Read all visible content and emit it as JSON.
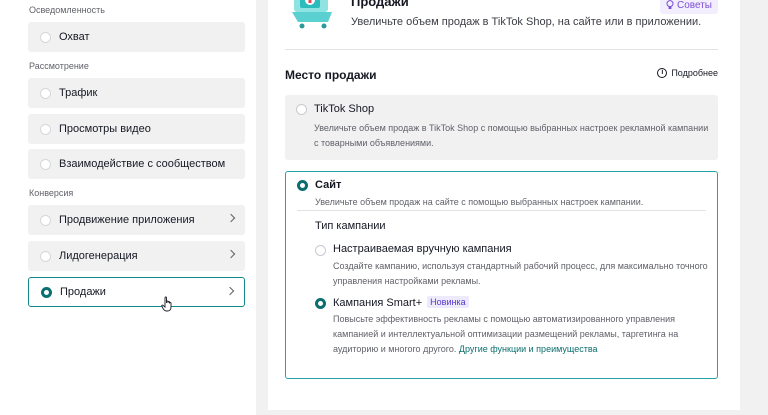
{
  "left": {
    "sections": [
      {
        "title": "Осведомленность",
        "items": [
          {
            "label": "Охват",
            "chevron": false
          }
        ]
      },
      {
        "title": "Рассмотрение",
        "items": [
          {
            "label": "Трафик",
            "chevron": false
          },
          {
            "label": "Просмотры видео",
            "chevron": false
          },
          {
            "label": "Взаимодействие с сообществом",
            "chevron": false
          }
        ]
      },
      {
        "title": "Конверсия",
        "items": [
          {
            "label": "Продвижение приложения",
            "chevron": true
          },
          {
            "label": "Лидогенерация",
            "chevron": true
          },
          {
            "label": "Продажи",
            "chevron": true,
            "selected": true
          }
        ]
      }
    ]
  },
  "header": {
    "title": "Продажи",
    "description": "Увеличьте объем продаж в TikTok Shop, на сайте или в приложении.",
    "tips_label": "Советы",
    "tips_icon": "lightbulb-icon"
  },
  "placement": {
    "title": "Место продажи",
    "more_label": "Подробнее",
    "tiktok_shop": {
      "label": "TikTok Shop",
      "description": "Увеличьте объем продаж в TikTok Shop с помощью выбранных настроек рекламной кампании с товарными объявлениями."
    },
    "site": {
      "label": "Сайт",
      "description": "Увеличьте объем продаж на сайте с помощью выбранных настроек кампании.",
      "campaign_type_title": "Тип кампании",
      "manual": {
        "label": "Настраиваемая вручную кампания",
        "description": "Создайте кампанию, используя стандартный рабочий процесс, для максимально точного управления настройками рекламы."
      },
      "smart": {
        "label": "Кампания Smart+",
        "badge": "Новинка",
        "description": "Повысьте эффективность рекламы с помощью автоматизированного управления кампанией и интеллектуальной оптимизации размещений рекламы, таргетинга на аудиторию и многого другого.",
        "link": "Другие функции и преимущества"
      }
    }
  },
  "colors": {
    "accent": "#0c6e6e",
    "border_selected": "#25a3a3",
    "badge_bg": "#eeeafd",
    "tips_fg": "#7a4fd6"
  }
}
